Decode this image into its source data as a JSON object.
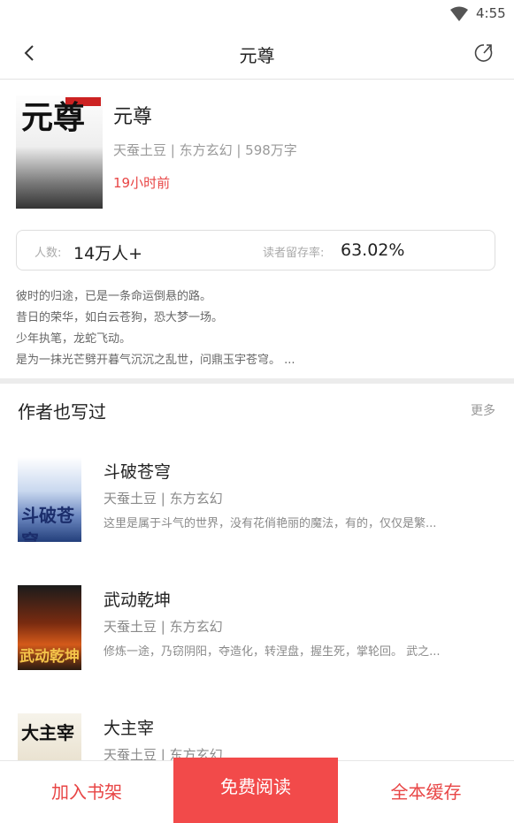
{
  "status_bar": {
    "time": "4:55"
  },
  "header": {
    "title": "元尊"
  },
  "book": {
    "cover_text": "元尊",
    "title": "元尊",
    "meta": "天蚕土豆 | 东方玄幻 | 598万字",
    "updated": "19小时前",
    "stats": {
      "readers_label": "人数:",
      "readers_value": "14万人+",
      "retention_label": "读者留存率:",
      "retention_value": "63.02%"
    },
    "description": [
      "彼时的归途，已是一条命运倒悬的路。",
      "昔日的荣华，如白云苍狗，恐大梦一场。",
      "少年执笔，龙蛇飞动。",
      "是为一抹光芒劈开暮气沉沉之乱世，问鼎玉宇苍穹。 ..."
    ]
  },
  "section": {
    "title": "作者也写过",
    "more_label": "更多"
  },
  "author_books": [
    {
      "cover_text": "斗破苍穹",
      "name": "斗破苍穹",
      "meta": "天蚕土豆 | 东方玄幻",
      "intro": "这里是属于斗气的世界，没有花俏艳丽的魔法，有的，仅仅是繁..."
    },
    {
      "cover_text": "武动乾坤",
      "name": "武动乾坤",
      "meta": "天蚕土豆 | 东方玄幻",
      "intro": "修炼一途，乃窃阴阳，夺造化，转涅盘，握生死，掌轮回。 武之..."
    },
    {
      "cover_text": "大主宰",
      "name": "大主宰",
      "meta": "天蚕土豆 | 东方玄幻",
      "intro": ""
    }
  ],
  "bottom_bar": {
    "add_shelf": "加入书架",
    "free_read": "免费阅读",
    "cache_all": "全本缓存"
  },
  "colors": {
    "accent": "#e84545",
    "read_button": "#f24a4a"
  }
}
